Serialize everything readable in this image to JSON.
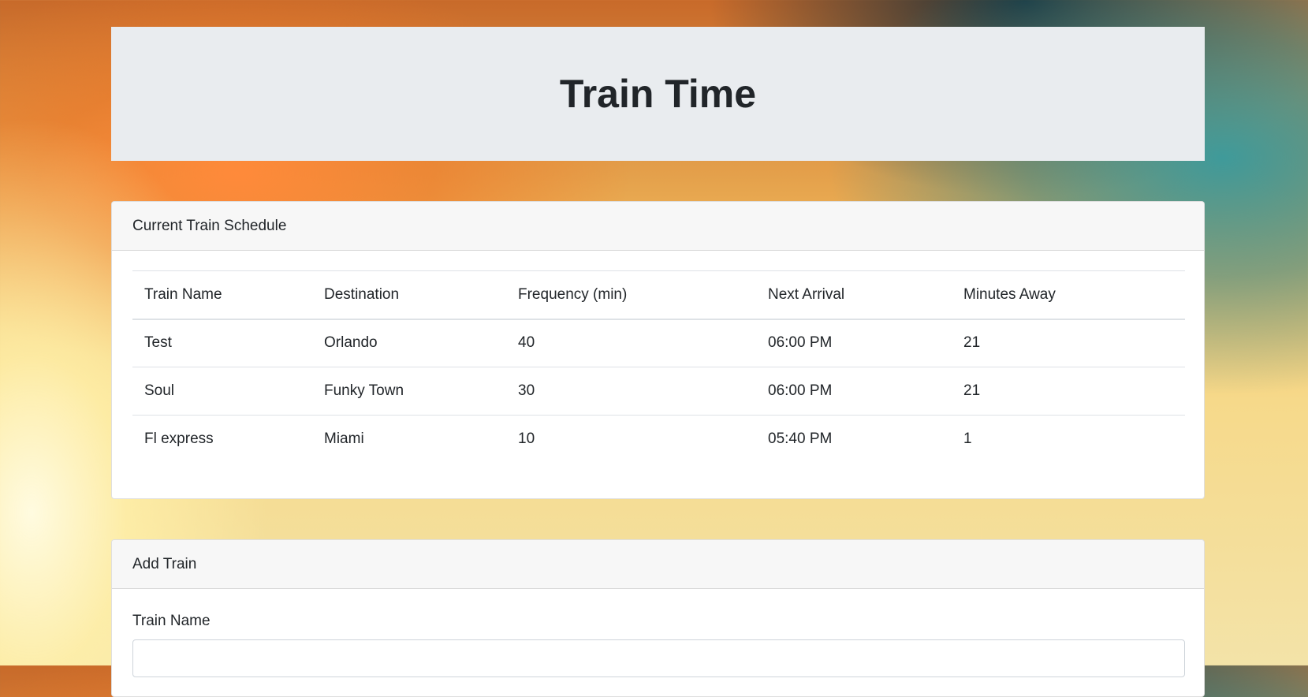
{
  "header": {
    "title": "Train Time"
  },
  "schedule": {
    "title": "Current Train Schedule",
    "columns": [
      "Train Name",
      "Destination",
      "Frequency (min)",
      "Next Arrival",
      "Minutes Away"
    ],
    "rows": [
      [
        "Test",
        "Orlando",
        "40",
        "06:00 PM",
        "21"
      ],
      [
        "Soul",
        "Funky Town",
        "30",
        "06:00 PM",
        "21"
      ],
      [
        "Fl express",
        "Miami",
        "10",
        "05:40 PM",
        "1"
      ]
    ]
  },
  "add_train": {
    "title": "Add Train",
    "train_name_label": "Train Name",
    "train_name_value": ""
  }
}
